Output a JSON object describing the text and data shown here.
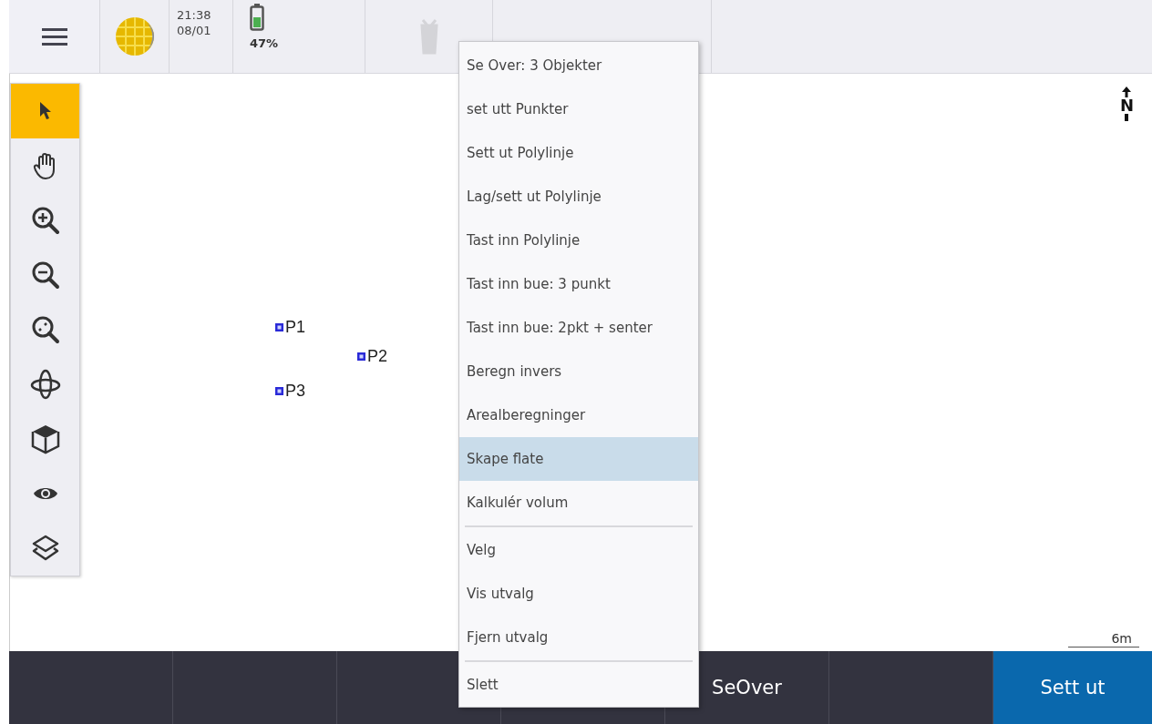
{
  "status_bar": {
    "time": "21:38",
    "date": "08/01",
    "battery": "47%",
    "delete_disabled": true
  },
  "tools": [
    {
      "kind": "select",
      "selected": true
    },
    {
      "kind": "pan",
      "selected": false
    },
    {
      "kind": "zoom_in",
      "selected": false
    },
    {
      "kind": "zoom_out",
      "selected": false
    },
    {
      "kind": "zoom_extents",
      "selected": false
    },
    {
      "kind": "orbit",
      "selected": false
    },
    {
      "kind": "cube",
      "selected": false
    },
    {
      "kind": "view",
      "selected": false
    },
    {
      "kind": "layers",
      "selected": false
    }
  ],
  "map": {
    "points": [
      {
        "label": "P1"
      },
      {
        "label": "P2"
      },
      {
        "label": "P3"
      }
    ],
    "north": "N",
    "scale": "6m"
  },
  "context_menu": [
    {
      "label": "Se Over: 3 Objekter",
      "selected": false,
      "separator_before": false
    },
    {
      "label": "set utt Punkter",
      "selected": false,
      "separator_before": false
    },
    {
      "label": "Sett ut Polylinje",
      "selected": false,
      "separator_before": false
    },
    {
      "label": "Lag/sett ut Polylinje",
      "selected": false,
      "separator_before": false
    },
    {
      "label": "Tast inn Polylinje",
      "selected": false,
      "separator_before": false
    },
    {
      "label": "Tast inn bue: 3 punkt",
      "selected": false,
      "separator_before": false
    },
    {
      "label": "Tast inn bue: 2pkt + senter",
      "selected": false,
      "separator_before": false
    },
    {
      "label": "Beregn invers",
      "selected": false,
      "separator_before": false
    },
    {
      "label": "Arealberegninger",
      "selected": false,
      "separator_before": false
    },
    {
      "label": "Skape flate",
      "selected": true,
      "separator_before": false
    },
    {
      "label": "Kalkulér volum",
      "selected": false,
      "separator_before": false
    },
    {
      "label": "Velg",
      "selected": false,
      "separator_before": true
    },
    {
      "label": "Vis utvalg",
      "selected": false,
      "separator_before": false
    },
    {
      "label": "Fjern utvalg",
      "selected": false,
      "separator_before": false
    },
    {
      "label": "Slett",
      "selected": false,
      "separator_before": true
    }
  ],
  "softkeys": [
    {
      "kind": "empty"
    },
    {
      "kind": "empty"
    },
    {
      "kind": "empty"
    },
    {
      "kind": "empty"
    },
    {
      "kind": "normal",
      "label": "SeOver"
    },
    {
      "kind": "empty"
    },
    {
      "kind": "primary",
      "label": "Sett ut"
    }
  ]
}
